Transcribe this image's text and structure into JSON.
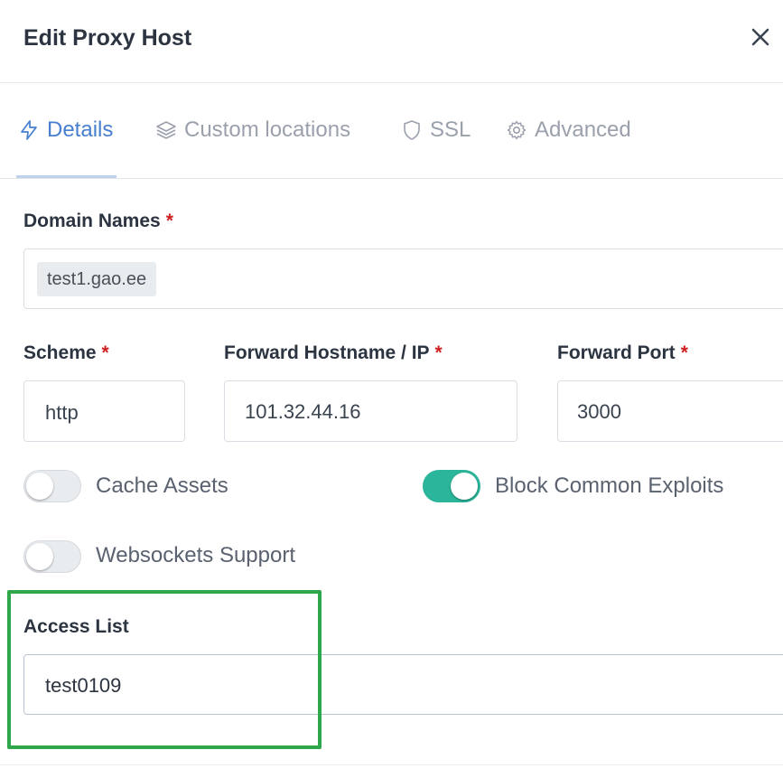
{
  "modal": {
    "title": "Edit Proxy Host",
    "close_symbol": "×"
  },
  "tabs": [
    {
      "label": "Details",
      "icon": "bolt-icon",
      "active": true
    },
    {
      "label": "Custom locations",
      "icon": "layers-icon",
      "active": false
    },
    {
      "label": "SSL",
      "icon": "shield-icon",
      "active": false
    },
    {
      "label": "Advanced",
      "icon": "gear-icon",
      "active": false
    }
  ],
  "form": {
    "domain_names": {
      "label": "Domain Names",
      "required_mark": "*",
      "chips": [
        "test1.gao.ee"
      ]
    },
    "scheme": {
      "label": "Scheme",
      "required_mark": "*",
      "value": "http"
    },
    "forward_host": {
      "label": "Forward Hostname / IP",
      "required_mark": "*",
      "value": "101.32.44.16"
    },
    "forward_port": {
      "label": "Forward Port",
      "required_mark": "*",
      "value": "3000"
    },
    "cache_assets": {
      "label": "Cache Assets",
      "enabled": false
    },
    "block_exploits": {
      "label": "Block Common Exploits",
      "enabled": true
    },
    "websockets": {
      "label": "Websockets Support",
      "enabled": false
    },
    "access_list": {
      "label": "Access List",
      "value": "test0109"
    }
  },
  "colors": {
    "accent": "#467fcf",
    "toggle_on": "#2bb59a",
    "required": "#cd201f",
    "highlight": "#2ea84a"
  }
}
